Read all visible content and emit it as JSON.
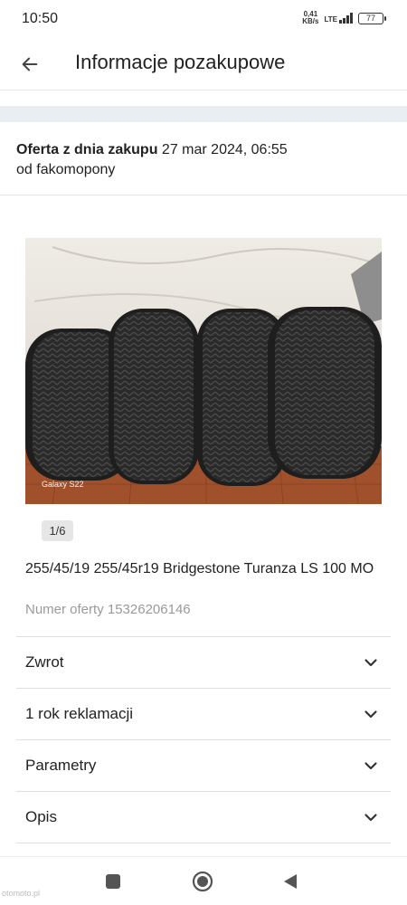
{
  "status_bar": {
    "time": "10:50",
    "net_speed_value": "0,41",
    "net_speed_unit": "KB/s",
    "network": "LTE",
    "battery": "77"
  },
  "app_bar": {
    "title": "Informacje pozakupowe",
    "back_icon": "arrow-left-icon"
  },
  "offer": {
    "label": "Oferta z dnia zakupu",
    "date": "27 mar 2024, 06:55",
    "seller_line": "od fakomopony"
  },
  "gallery": {
    "counter": "1/6",
    "photo_caption": "Galaxy S22"
  },
  "product": {
    "title": "255/45/19 255/45r19 Bridgestone Turanza LS 100 MO",
    "offer_number": "Numer oferty 15326206146"
  },
  "sections": [
    {
      "label": "Zwrot",
      "icon": "chevron-down-icon"
    },
    {
      "label": "1 rok reklamacji",
      "icon": "chevron-down-icon"
    },
    {
      "label": "Parametry",
      "icon": "chevron-down-icon"
    },
    {
      "label": "Opis",
      "icon": "chevron-down-icon"
    }
  ],
  "nav": {
    "recents_icon": "square-icon",
    "home_icon": "circle-home-icon",
    "back_icon": "triangle-back-icon"
  },
  "watermark": "otomoto.pl",
  "colors": {
    "band": "#e9eef3",
    "muted_text": "#9a9a9a",
    "divider": "#dedede"
  }
}
